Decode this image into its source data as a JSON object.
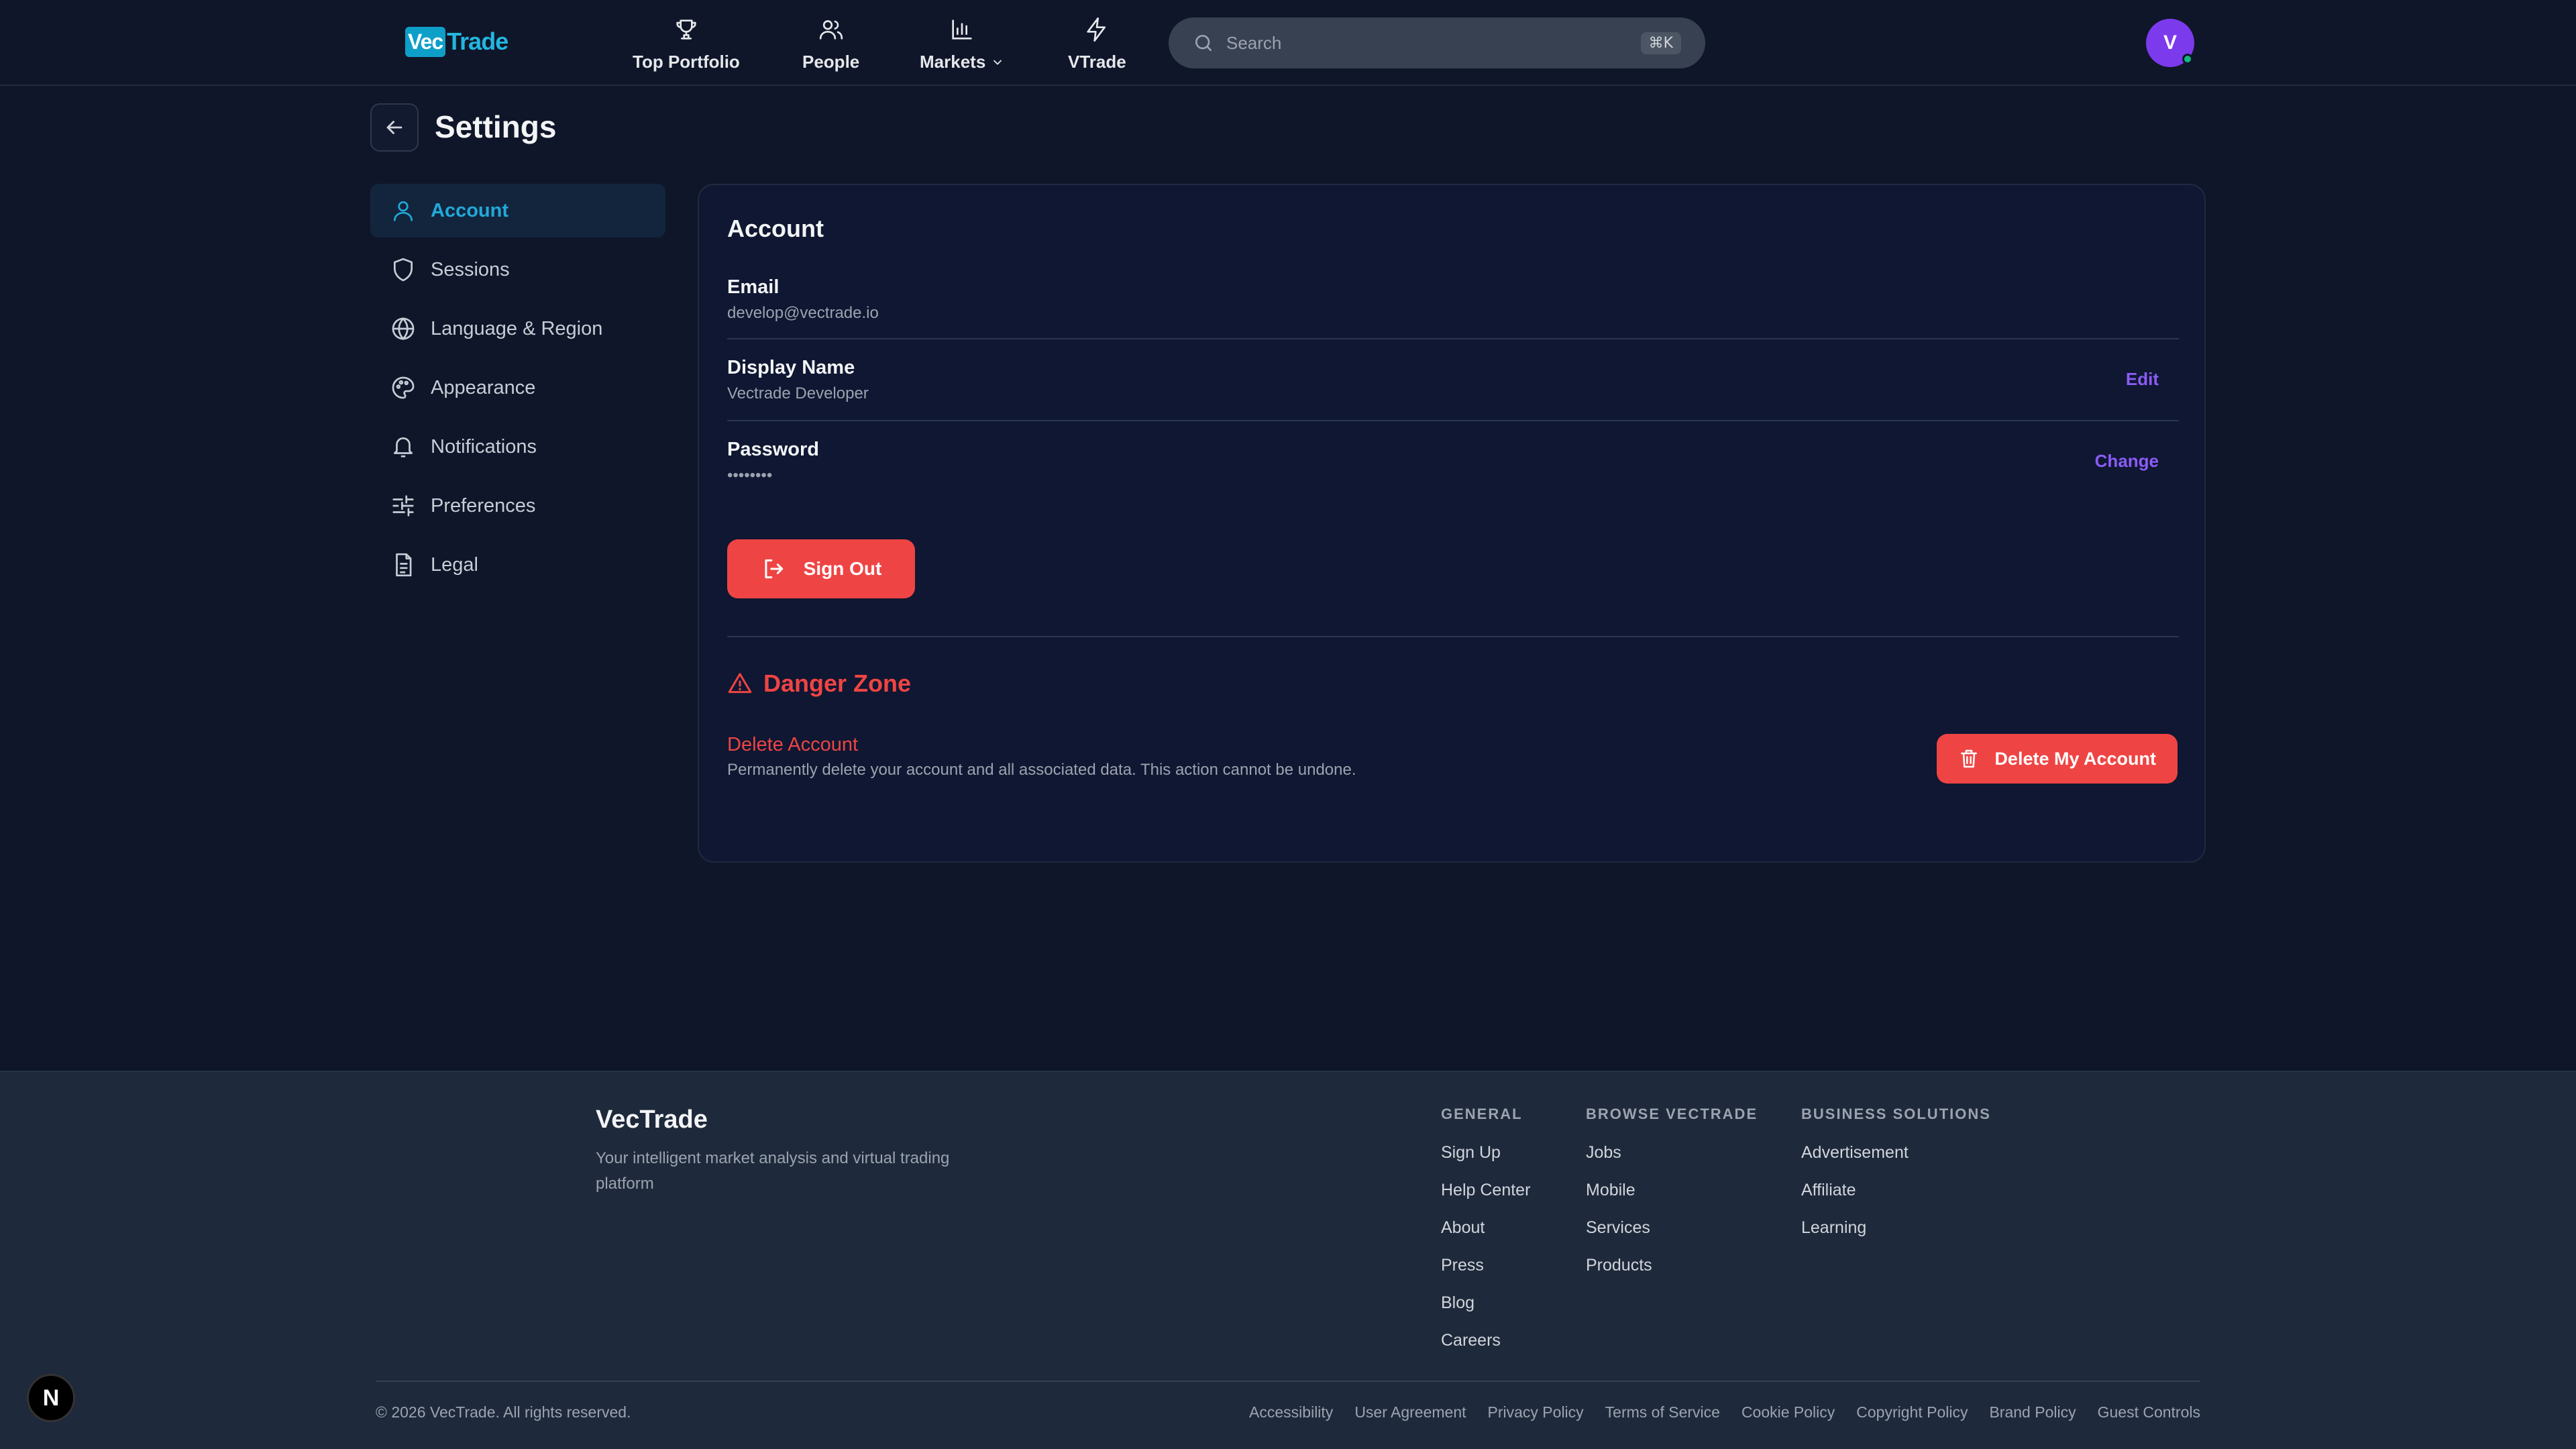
{
  "header": {
    "logo_vec": "Vec",
    "logo_trade": "Trade",
    "nav": [
      {
        "label": "Top Portfolio",
        "icon": "trophy-icon"
      },
      {
        "label": "People",
        "icon": "people-icon"
      },
      {
        "label": "Markets",
        "icon": "bar-chart-icon"
      },
      {
        "label": "VTrade",
        "icon": "lightning-icon"
      }
    ],
    "search_placeholder": "Search",
    "search_shortcut": "⌘K",
    "avatar_initial": "V"
  },
  "page": {
    "title": "Settings"
  },
  "sidebar": {
    "items": [
      {
        "label": "Account",
        "icon": "user-icon",
        "active": true
      },
      {
        "label": "Sessions",
        "icon": "shield-icon"
      },
      {
        "label": "Language & Region",
        "icon": "globe-icon"
      },
      {
        "label": "Appearance",
        "icon": "palette-icon"
      },
      {
        "label": "Notifications",
        "icon": "bell-icon"
      },
      {
        "label": "Preferences",
        "icon": "sliders-icon"
      },
      {
        "label": "Legal",
        "icon": "document-icon"
      }
    ]
  },
  "account": {
    "title": "Account",
    "email_label": "Email",
    "email_value": "develop@vectrade.io",
    "display_name_label": "Display Name",
    "display_name_value": "Vectrade Developer",
    "edit_label": "Edit",
    "password_label": "Password",
    "password_value": "••••••••",
    "change_label": "Change",
    "sign_out_label": "Sign Out"
  },
  "danger": {
    "title": "Danger Zone",
    "delete_label": "Delete Account",
    "delete_desc": "Permanently delete your account and all associated data. This action cannot be undone.",
    "delete_button": "Delete My Account"
  },
  "footer": {
    "brand": "VecTrade",
    "tagline": "Your intelligent market analysis and virtual trading platform",
    "columns": [
      {
        "heading": "GENERAL",
        "links": [
          "Sign Up",
          "Help Center",
          "About",
          "Press",
          "Blog",
          "Careers"
        ]
      },
      {
        "heading": "BROWSE VECTRADE",
        "links": [
          "Jobs",
          "Mobile",
          "Services",
          "Products"
        ]
      },
      {
        "heading": "BUSINESS SOLUTIONS",
        "links": [
          "Advertisement",
          "Affiliate",
          "Learning"
        ]
      }
    ],
    "copyright": "© 2026 VecTrade. All rights reserved.",
    "legal_links": [
      "Accessibility",
      "User Agreement",
      "Privacy Policy",
      "Terms of Service",
      "Cookie Policy",
      "Copyright Policy",
      "Brand Policy",
      "Guest Controls"
    ]
  },
  "dev_badge": "N",
  "colors": {
    "background": "#0f1629",
    "accent": "#22a9d8",
    "link": "#8b5cf6",
    "danger": "#ef4444",
    "footer_bg": "#1e293b"
  }
}
